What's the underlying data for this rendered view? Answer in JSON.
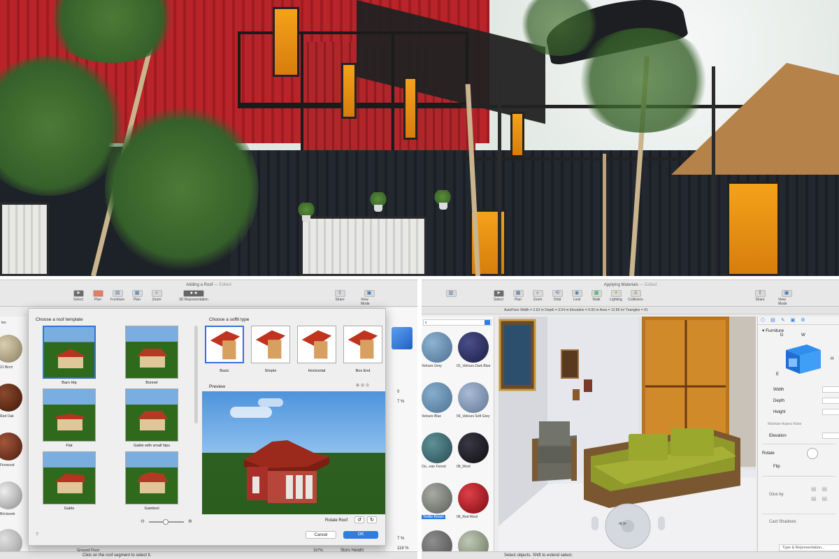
{
  "photo": {
    "description_icon": "container-house-photo"
  },
  "roof_app": {
    "window_title": "Adding a Roof",
    "window_state": "— Edited",
    "toolbar": [
      {
        "label": "Select",
        "icon": "cursor-icon",
        "selected": true
      },
      {
        "label": "Plan",
        "icon": "plan-icon"
      },
      {
        "label": "Furniture",
        "icon": "furniture-icon"
      },
      {
        "label": "Plan",
        "icon": "plan2-icon"
      },
      {
        "label": "Zoom",
        "icon": "zoom-icon"
      },
      {
        "label": "3D Representation",
        "icon": "3d-icon"
      }
    ],
    "toolbar_right": [
      "Share",
      "View Mode"
    ],
    "materials": [
      {
        "label": "21 Birch",
        "color": "#b8ab8a"
      },
      {
        "label": "Red Oak",
        "color": "#6a3420"
      },
      {
        "label": "Firewood",
        "color": "#7a3a22"
      },
      {
        "label": "Brickwork",
        "color": "#c9c9c9"
      }
    ],
    "materials_header": "tes",
    "dialog": {
      "template_heading": "Choose a roof template",
      "templates": [
        "Barn Hip",
        "Bonnet",
        "Flat",
        "Gable with small hips",
        "Gable",
        "Gambrel"
      ],
      "soffit_heading": "Choose a soffit type",
      "soffits": [
        "Basic",
        "Simple",
        "Horizontal",
        "Box End"
      ],
      "preview_heading": "Preview",
      "rotate_label": "Rotate Roof",
      "cancel": "Cancel",
      "ok": "OK"
    },
    "side_values": [
      "0",
      "7 %",
      "7 %",
      "118 %"
    ],
    "bottom_row": {
      "level": "Ground Floor",
      "percent": "107%",
      "story_height": "Story Height"
    },
    "status": "Click on the roof segment to select it."
  },
  "material_app": {
    "window_title": "Applying Materials",
    "window_state": "— Edited",
    "toolbar": [
      {
        "label": "Select",
        "icon": "cursor-icon",
        "selected": true
      },
      {
        "label": "Plan",
        "icon": "plan-icon"
      },
      {
        "label": "Zoom",
        "icon": "zoom-icon"
      },
      {
        "label": "Orbit",
        "icon": "orbit-icon"
      },
      {
        "label": "Look",
        "icon": "eye-icon"
      },
      {
        "label": "Walk",
        "icon": "walk-icon"
      },
      {
        "label": "Lighting",
        "icon": "bulb-icon"
      },
      {
        "label": "Collisions",
        "icon": "figure-icon"
      }
    ],
    "toolbar_right": [
      "Share",
      "View Mode"
    ],
    "info_strip": "AutoFloor    Width = 3.63 m   Depth = 3.54 m   Elevation = 0.00 m   Area = 12.85 m²   Triangles = 41",
    "materials": [
      {
        "label": "Velours Grey",
        "color": "#6a8fae"
      },
      {
        "label": "02_Velours Dark Blue",
        "color": "#2a2f62"
      },
      {
        "label": "Velours Blue",
        "color": "#5f87a8"
      },
      {
        "label": "04_Velours Soft Grey",
        "color": "#7d93b0"
      },
      {
        "label": "Ou...ean Forest",
        "color": "#3c6b72"
      },
      {
        "label": "08_Wool",
        "color": "#1c1b22"
      },
      {
        "label": "Textile Brown",
        "color": "#7b8079"
      },
      {
        "label": "08_Red Wool",
        "color": "#c01820"
      }
    ],
    "materials_header": "c",
    "inspector": {
      "tab_title": "Furniture",
      "dims": [
        "D",
        "W",
        "H",
        "E"
      ],
      "width_label": "Width",
      "depth_label": "Depth",
      "height_label": "Height",
      "aspect_label": "Maintain Aspect Ratio",
      "elevation_label": "Elevation",
      "rotate_label": "Rotate",
      "flip_label": "Flip",
      "glue_label": "Glue by",
      "shadows_label": "Cast Shadows",
      "type_label": "Type & Representation..."
    },
    "status": "Select objects. Shift to extend select."
  }
}
